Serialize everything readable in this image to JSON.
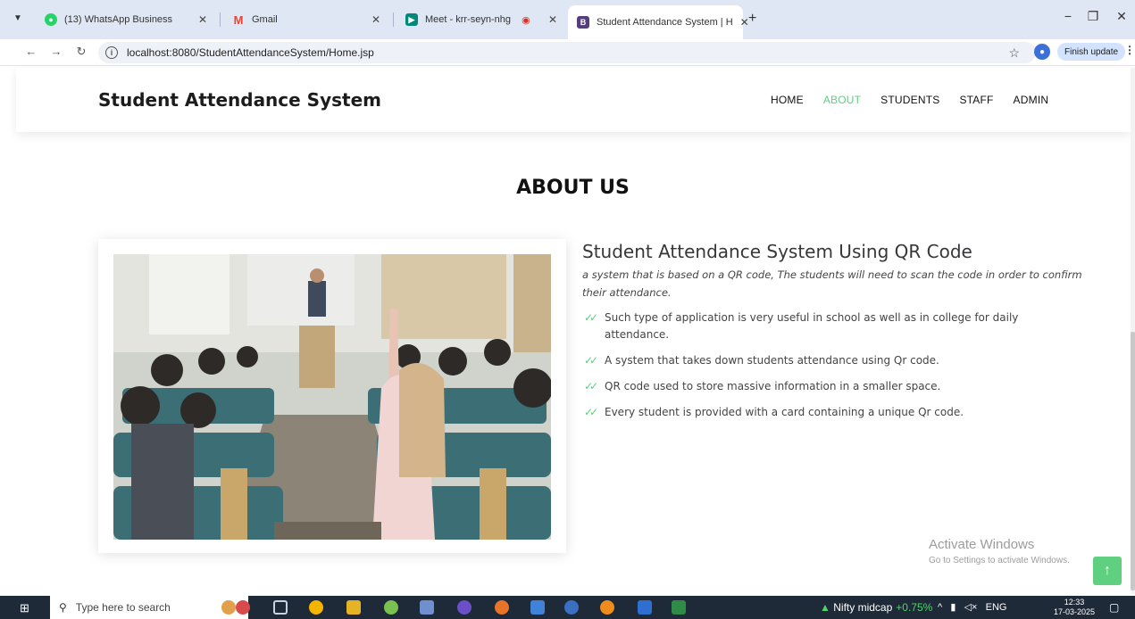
{
  "browser": {
    "tabs": [
      {
        "title": "(13) WhatsApp Business",
        "icon": "whatsapp-icon",
        "color": "#25d366"
      },
      {
        "title": "Gmail",
        "icon": "gmail-icon",
        "color": "#ea4335"
      },
      {
        "title": "Meet - krr-seyn-nhg",
        "icon": "meet-icon",
        "color": "#00897b"
      },
      {
        "title": "Student Attendance System | H",
        "icon": "bootstrap-icon",
        "color": "#563d7c"
      }
    ],
    "url": "localhost:8080/StudentAttendanceSystem/Home.jsp",
    "finish_update_label": "Finish update"
  },
  "site": {
    "brand": "Student Attendance System",
    "nav": [
      "HOME",
      "ABOUT",
      "STUDENTS",
      "STAFF",
      "ADMIN"
    ],
    "active_nav": "ABOUT",
    "accent_color": "#5fcf80"
  },
  "about": {
    "section_title": "ABOUT US",
    "heading": "Student Attendance System Using QR Code",
    "lead": "a system that is based on a QR code, The students will need to scan the code in order to confirm their attendance.",
    "points": [
      "Such type of application is very useful in school as well as in college for daily attendance.",
      "A system that takes down students attendance using Qr code.",
      "QR code used to store massive information in a smaller space.",
      "Every student is provided with a card containing a unique Qr code."
    ]
  },
  "watermark": {
    "line1": "Activate Windows",
    "line2": "Go to Settings to activate Windows."
  },
  "taskbar": {
    "search_placeholder": "Type here to search",
    "ticker_label": "Nifty midcap",
    "ticker_change": "+0.75%",
    "language": "ENG",
    "time": "12:33",
    "date": "17-03-2025"
  }
}
